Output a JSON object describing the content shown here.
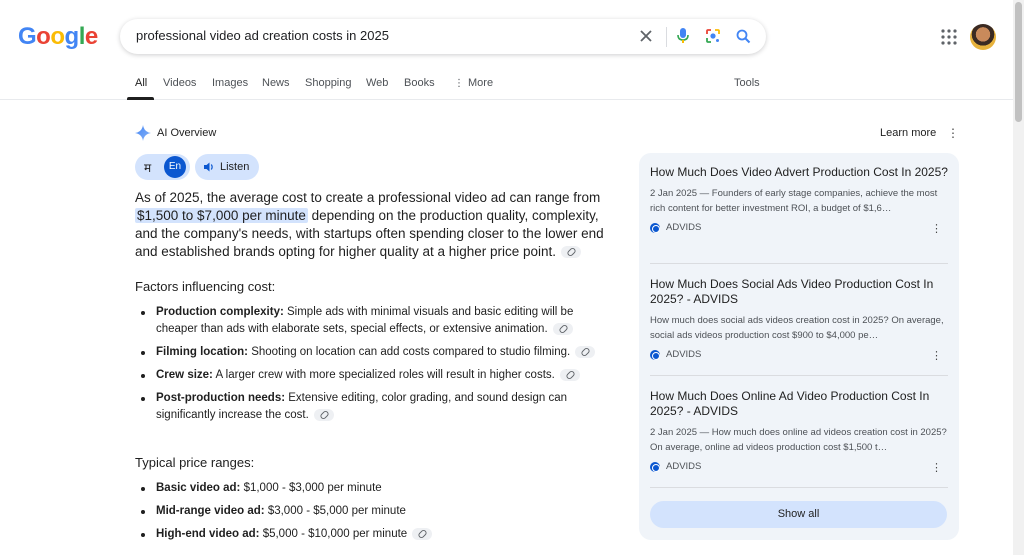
{
  "logo": {
    "text": "Google"
  },
  "search": {
    "query": "professional video ad creation costs in 2025"
  },
  "tabs": [
    {
      "label": "All"
    },
    {
      "label": "Videos"
    },
    {
      "label": "Images"
    },
    {
      "label": "News"
    },
    {
      "label": "Shopping"
    },
    {
      "label": "Web"
    },
    {
      "label": "Books"
    },
    {
      "label": "More"
    }
  ],
  "tools_label": "Tools",
  "ai_overview": {
    "title": "AI Overview",
    "learn_more": "Learn more",
    "lang_m": "म",
    "lang_en": "En",
    "listen": "Listen",
    "para_pre": "As of 2025, the average cost to create a professional video ad can range from ",
    "para_hl": "$1,500 to $7,000 per minute",
    "para_post": " depending on the production quality, complexity, and the company's needs, with startups often spending closer to the lower end and established brands opting for higher quality at a higher price point.",
    "factors_heading": "Factors influencing cost:",
    "factors": [
      {
        "bold": "Production complexity:",
        "text": " Simple ads with minimal visuals and basic editing will be cheaper than ads with elaborate sets, special effects, or extensive animation."
      },
      {
        "bold": "Filming location:",
        "text": " Shooting on location can add costs compared to studio filming."
      },
      {
        "bold": "Crew size:",
        "text": " A larger crew with more specialized roles will result in higher costs."
      },
      {
        "bold": "Post-production needs:",
        "text": " Extensive editing, color grading, and sound design can significantly increase the cost."
      }
    ],
    "prices_heading": "Typical price ranges:",
    "prices": [
      {
        "bold": "Basic video ad:",
        "text": " $1,000 - $3,000 per minute"
      },
      {
        "bold": "Mid-range video ad:",
        "text": " $3,000 - $5,000 per minute"
      },
      {
        "bold": "High-end video ad:",
        "text": " $5,000 - $10,000 per minute"
      }
    ]
  },
  "sources": [
    {
      "title": "How Much Does Video Advert Production Cost In 2025?",
      "snippet": "2 Jan 2025 — Founders of early stage companies, achieve the most rich content for better investment ROI, a budget of $1,6…",
      "site": "ADVIDS"
    },
    {
      "title": "How Much Does Social Ads Video Production Cost In 2025? - ADVIDS",
      "snippet": "How much does social ads videos creation cost in 2025? On average, social ads videos production cost $900 to $4,000 pe…",
      "site": "ADVIDS"
    },
    {
      "title": "How Much Does Online Ad Video Production Cost In 2025? - ADVIDS",
      "snippet": "2 Jan 2025 — How much does online ad videos creation cost in 2025? On average, online ad videos production cost $1,500 t…",
      "site": "ADVIDS"
    }
  ],
  "show_all": "Show all"
}
